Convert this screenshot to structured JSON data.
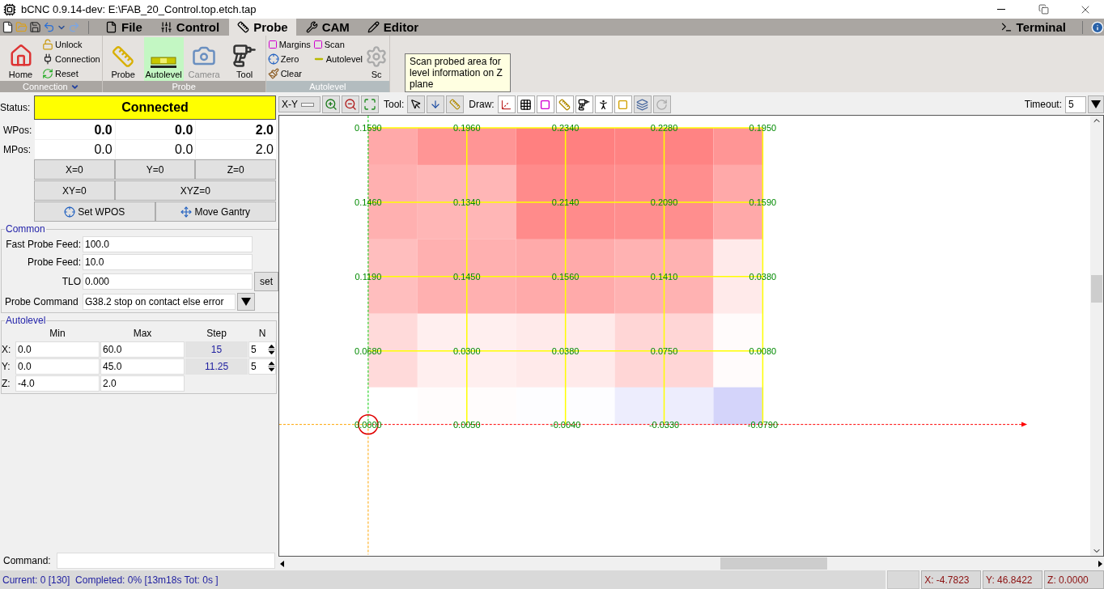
{
  "window": {
    "title": "bCNC 0.9.14-dev: E:\\FAB_20_Control.top.etch.tap"
  },
  "ribbon_tabs": [
    {
      "label": "File",
      "selected": false
    },
    {
      "label": "Control",
      "selected": false
    },
    {
      "label": "Probe",
      "selected": true
    },
    {
      "label": "CAM",
      "selected": false
    },
    {
      "label": "Editor",
      "selected": false
    }
  ],
  "terminal_tab": {
    "label": "Terminal"
  },
  "ribbon_groups": [
    {
      "title": "Connection",
      "selected": false,
      "menu": true,
      "columns": [
        [
          {
            "label": "Home",
            "kind": "large",
            "selected": false,
            "disabled": false
          }
        ],
        [
          {
            "label": "Unlock",
            "kind": "small",
            "selected": false,
            "disabled": false
          },
          {
            "label": "Connection",
            "kind": "small",
            "selected": false,
            "disabled": false
          },
          {
            "label": "Reset",
            "kind": "small",
            "selected": false,
            "disabled": false
          }
        ]
      ]
    },
    {
      "title": "Probe",
      "selected": false,
      "menu": false,
      "columns": [
        [
          {
            "label": "Probe",
            "kind": "large",
            "selected": false,
            "disabled": false
          }
        ],
        [
          {
            "label": "Autolevel",
            "kind": "large",
            "selected": true,
            "disabled": false
          }
        ],
        [
          {
            "label": "Camera",
            "kind": "large",
            "selected": false,
            "disabled": true
          }
        ],
        [
          {
            "label": "Tool",
            "kind": "large",
            "selected": false,
            "disabled": false
          }
        ]
      ]
    },
    {
      "title": "Autolevel",
      "selected": true,
      "menu": false,
      "columns": [
        [
          {
            "label": "Margins",
            "kind": "small",
            "selected": false,
            "disabled": false
          },
          {
            "label": "Zero",
            "kind": "small",
            "selected": false,
            "disabled": false
          },
          {
            "label": "Clear",
            "kind": "small",
            "selected": false,
            "disabled": false
          }
        ],
        [
          {
            "label": "Scan",
            "kind": "small",
            "selected": false,
            "disabled": false
          },
          {
            "label": "Autolevel",
            "kind": "small",
            "selected": false,
            "disabled": false
          }
        ],
        [
          {
            "label": "Sc",
            "kind": "large",
            "selected": false,
            "disabled": false
          }
        ]
      ]
    }
  ],
  "tooltip": {
    "text": "Scan probed area for level information on Z plane"
  },
  "status": {
    "label": "Status:",
    "value": "Connected"
  },
  "positions": [
    {
      "label": "WPos:",
      "kind": "work",
      "values": [
        "0.0",
        "0.0",
        "2.0"
      ]
    },
    {
      "label": "MPos:",
      "kind": "machine",
      "values": [
        "0.0",
        "0.0",
        "2.0"
      ]
    }
  ],
  "zero_buttons": [
    [
      "X=0",
      "Y=0",
      "Z=0"
    ],
    [
      "XY=0",
      "XYZ=0"
    ]
  ],
  "position_buttons": [
    "Set WPOS",
    "Move Gantry"
  ],
  "common": {
    "title": "Common",
    "fields": [
      {
        "label": "Fast Probe Feed:",
        "value": "100.0"
      },
      {
        "label": "Probe Feed:",
        "value": "10.0"
      },
      {
        "label": "TLO",
        "value": "0.000",
        "button": "set"
      }
    ],
    "probe_command": {
      "label": "Probe Command",
      "value": "G38.2 stop on contact else error"
    }
  },
  "autolevel": {
    "title": "Autolevel",
    "headers": [
      "Min",
      "Max",
      "Step",
      "N"
    ],
    "rows": [
      {
        "label": "X:",
        "min": "0.0",
        "max": "60.0",
        "step": "15",
        "n": "5"
      },
      {
        "label": "Y:",
        "min": "0.0",
        "max": "45.0",
        "step": "11.25",
        "n": "5"
      },
      {
        "label": "Z:",
        "min": "-4.0",
        "max": "2.0"
      }
    ]
  },
  "command": {
    "label": "Command:"
  },
  "canvas_toolbar": {
    "view": "X-Y",
    "tool_label": "Tool:",
    "draw_label": "Draw:",
    "timeout": {
      "label": "Timeout:",
      "value": "5"
    }
  },
  "probe_map": {
    "values": [
      [
        "0.1590",
        "0.1960",
        "0.2340",
        "0.2280",
        "0.1950"
      ],
      [
        "0.1460",
        "0.1340",
        "0.2140",
        "0.2090",
        "0.1590"
      ],
      [
        "0.1190",
        "0.1450",
        "0.1560",
        "0.1410",
        "0.0380"
      ],
      [
        "0.0680",
        "0.0300",
        "0.0380",
        "0.0750",
        "0.0080"
      ],
      [
        "0.0000",
        "0.0050",
        "-0.0040",
        "-0.0330",
        "-0.0790"
      ]
    ]
  },
  "status_bar": {
    "progress": "Current: 0 [130]  Completed: 0% [13m18s Tot: 0s ]",
    "coords": [
      "X: -4.7823",
      "Y: 46.8422",
      "Z: 0.0000"
    ]
  }
}
